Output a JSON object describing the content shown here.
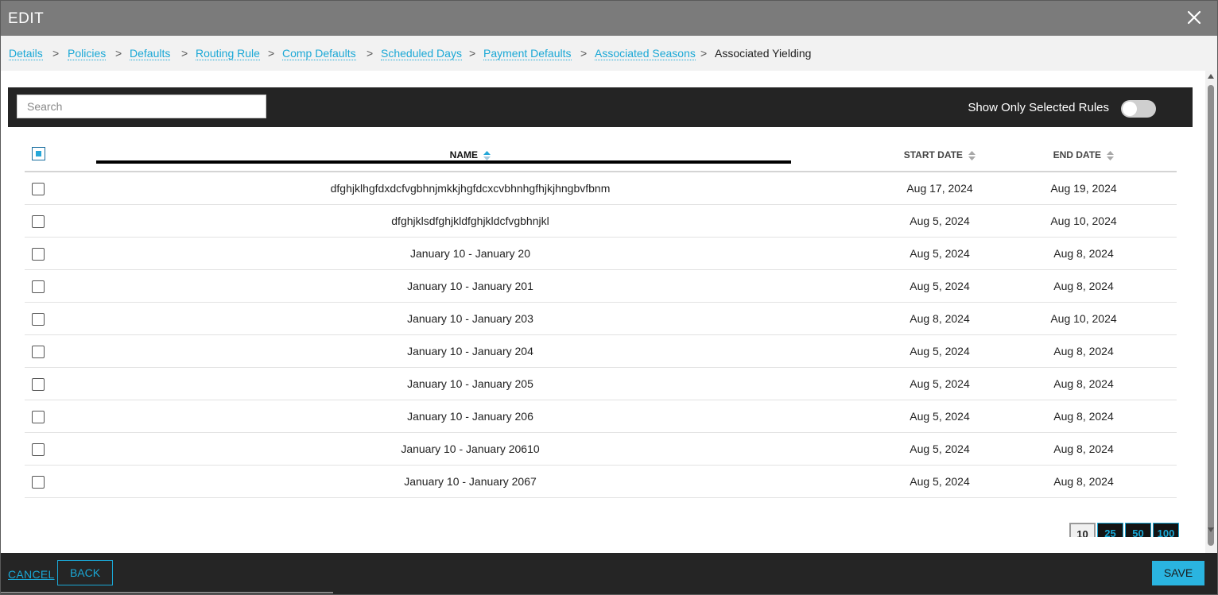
{
  "window": {
    "title": "EDIT"
  },
  "breadcrumbs": {
    "items": [
      "Details",
      "Policies",
      "Defaults",
      "Routing Rule",
      "Comp Defaults",
      "Scheduled Days",
      "Payment Defaults",
      "Associated Seasons"
    ],
    "separator": ">",
    "current": "Associated Yielding"
  },
  "toolbar": {
    "search_placeholder": "Search",
    "search_value": "",
    "toggle_label": "Show Only Selected Rules",
    "toggle_on": false
  },
  "table": {
    "columns": {
      "name": "NAME",
      "start": "START DATE",
      "end": "END DATE"
    },
    "rows": [
      {
        "name": "dfghjklhgfdxdcfvgbhnjmkkjhgfdcxcvbhnhgfhjkjhngbvfbnm",
        "start": "Aug 17, 2024",
        "end": "Aug 19, 2024"
      },
      {
        "name": "dfghjklsdfghjkldfghjkldcfvgbhnjkl",
        "start": "Aug 5, 2024",
        "end": "Aug 10, 2024"
      },
      {
        "name": "January 10 - January 20",
        "start": "Aug 5, 2024",
        "end": "Aug 8, 2024"
      },
      {
        "name": "January 10 - January 201",
        "start": "Aug 5, 2024",
        "end": "Aug 8, 2024"
      },
      {
        "name": "January 10 - January 203",
        "start": "Aug 8, 2024",
        "end": "Aug 10, 2024"
      },
      {
        "name": "January 10 - January 204",
        "start": "Aug 5, 2024",
        "end": "Aug 8, 2024"
      },
      {
        "name": "January 10 - January 205",
        "start": "Aug 5, 2024",
        "end": "Aug 8, 2024"
      },
      {
        "name": "January 10 - January 206",
        "start": "Aug 5, 2024",
        "end": "Aug 8, 2024"
      },
      {
        "name": "January 10 - January 20610",
        "start": "Aug 5, 2024",
        "end": "Aug 8, 2024"
      },
      {
        "name": "January 10 - January 2067",
        "start": "Aug 5, 2024",
        "end": "Aug 8, 2024"
      }
    ]
  },
  "pagination": {
    "sizes": [
      "10",
      "25",
      "50",
      "100"
    ],
    "selected": "10"
  },
  "footer": {
    "cancel": "CANCEL",
    "back": "BACK",
    "save": "SAVE"
  },
  "colors": {
    "accent": "#1aa8d6",
    "title_bar": "#7b7b7b",
    "toolbar_bg": "#242424",
    "footer_bg": "#252525",
    "save_bg": "#2ab4e0"
  },
  "icons": {
    "close": "close-icon",
    "sort": "sort-icon",
    "sort_active": "sort-asc-icon"
  }
}
